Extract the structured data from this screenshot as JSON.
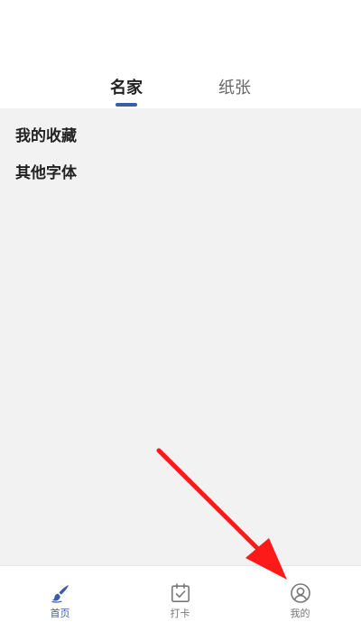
{
  "tabs": [
    {
      "label": "名家",
      "active": true
    },
    {
      "label": "纸张",
      "active": false
    }
  ],
  "list": [
    {
      "label": "我的收藏"
    },
    {
      "label": "其他字体"
    }
  ],
  "bottom_nav": [
    {
      "label": "首页",
      "icon": "brush-icon",
      "active": true
    },
    {
      "label": "打卡",
      "icon": "calendar-check-icon",
      "active": false
    },
    {
      "label": "我的",
      "icon": "user-icon",
      "active": false
    }
  ],
  "colors": {
    "accent": "#3a5da8",
    "arrow": "#ff1a1a",
    "content_bg": "#f2f2f3"
  }
}
